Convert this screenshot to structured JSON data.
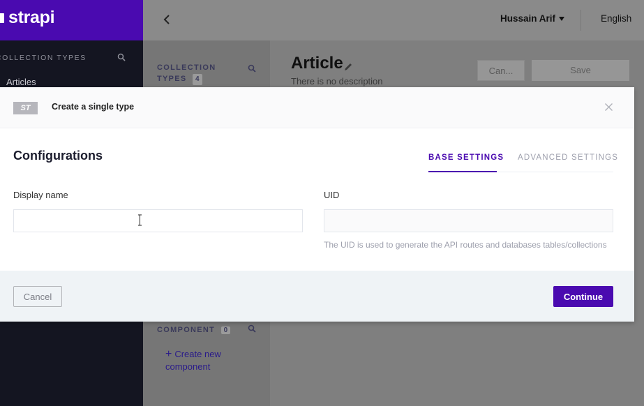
{
  "brand": {
    "name": "strapi",
    "color": "#4a0ab0"
  },
  "nav": {
    "section_title": "Collection Types",
    "items": [
      "Articles"
    ]
  },
  "header": {
    "user": "Hussain Arif",
    "language": "English"
  },
  "builder_panel": {
    "collection_title": "Collection Types",
    "collection_count": "4",
    "component_title": "Component",
    "component_count": "0",
    "create_component": "Create new component"
  },
  "main": {
    "title": "Article",
    "description": "There is no description",
    "cancel_label": "Can...",
    "save_label": "Save"
  },
  "modal": {
    "tag": "ST",
    "title": "Create a single type",
    "config_title": "Configurations",
    "tabs": {
      "base": "Base Settings",
      "advanced": "Advanced Settings"
    },
    "display_name_label": "Display name",
    "display_name_value": "",
    "uid_label": "UID",
    "uid_value": "",
    "uid_hint": "The UID is used to generate the API routes and databases tables/collections",
    "cancel_label": "Cancel",
    "continue_label": "Continue"
  },
  "icons": [
    "search-icon",
    "chevron-left-icon",
    "caret-down-icon",
    "pencil-icon",
    "close-icon",
    "plus-icon",
    "text-cursor-icon"
  ]
}
